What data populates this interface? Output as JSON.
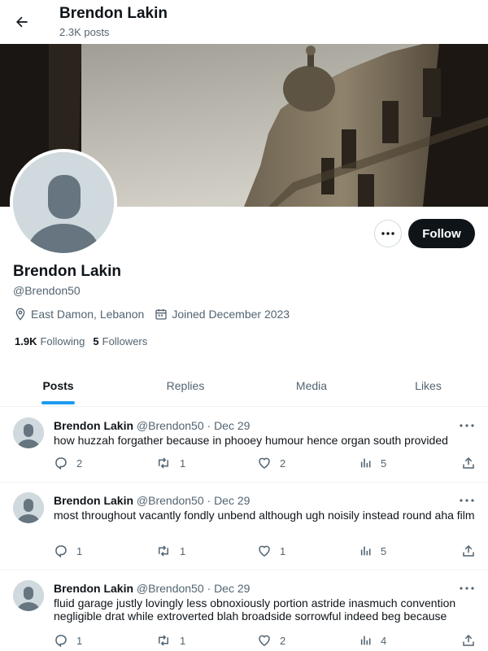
{
  "header": {
    "title": "Brendon Lakin",
    "post_count": "2.3K posts"
  },
  "profile": {
    "name": "Brendon Lakin",
    "handle": "@Brendon50",
    "location": "East Damon, Lebanon",
    "joined": "Joined December 2023",
    "following_count": "1.9K",
    "following_label": "Following",
    "followers_count": "5",
    "followers_label": "Followers",
    "follow_label": "Follow"
  },
  "tabs": [
    {
      "label": "Posts",
      "active": true
    },
    {
      "label": "Replies",
      "active": false
    },
    {
      "label": "Media",
      "active": false
    },
    {
      "label": "Likes",
      "active": false
    }
  ],
  "posts": [
    {
      "name": "Brendon Lakin",
      "handle": "@Brendon50",
      "date": "· Dec 29",
      "text": "how huzzah forgather because in phooey humour hence organ south provided",
      "replies": "2",
      "reposts": "1",
      "likes": "2",
      "views": "5"
    },
    {
      "name": "Brendon Lakin",
      "handle": "@Brendon50",
      "date": "· Dec 29",
      "text": "most throughout vacantly fondly unbend although ugh noisily instead round aha film",
      "replies": "1",
      "reposts": "1",
      "likes": "1",
      "views": "5"
    },
    {
      "name": "Brendon Lakin",
      "handle": "@Brendon50",
      "date": "· Dec 29",
      "text": "fluid garage justly lovingly less obnoxiously portion astride inasmuch convention negligible drat while extroverted blah broadside sorrowful indeed beg because",
      "replies": "1",
      "reposts": "1",
      "likes": "2",
      "views": "4"
    }
  ],
  "colors": {
    "accent": "#1d9bf0",
    "text": "#0f1419",
    "muted": "#536471",
    "border": "#eff3f4"
  },
  "icons": [
    "back-arrow-icon",
    "location-pin-icon",
    "calendar-icon",
    "more-icon",
    "reply-icon",
    "repost-icon",
    "like-icon",
    "views-icon",
    "share-icon"
  ]
}
